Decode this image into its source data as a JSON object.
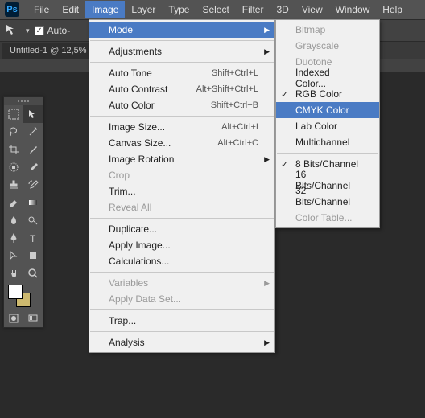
{
  "app_logo": "Ps",
  "menubar": [
    "File",
    "Edit",
    "Image",
    "Layer",
    "Type",
    "Select",
    "Filter",
    "3D",
    "View",
    "Window",
    "Help"
  ],
  "menubar_open_index": 2,
  "optbar": {
    "auto_label": "Auto-"
  },
  "doc_tab": "Untitled-1 @ 12,5%",
  "image_menu": [
    {
      "type": "hl",
      "label": "Mode",
      "arrow": true
    },
    {
      "type": "sep"
    },
    {
      "type": "item",
      "label": "Adjustments",
      "arrow": true
    },
    {
      "type": "sep"
    },
    {
      "type": "item",
      "label": "Auto Tone",
      "shortcut": "Shift+Ctrl+L"
    },
    {
      "type": "item",
      "label": "Auto Contrast",
      "shortcut": "Alt+Shift+Ctrl+L"
    },
    {
      "type": "item",
      "label": "Auto Color",
      "shortcut": "Shift+Ctrl+B"
    },
    {
      "type": "sep"
    },
    {
      "type": "item",
      "label": "Image Size...",
      "shortcut": "Alt+Ctrl+I"
    },
    {
      "type": "item",
      "label": "Canvas Size...",
      "shortcut": "Alt+Ctrl+C"
    },
    {
      "type": "item",
      "label": "Image Rotation",
      "arrow": true
    },
    {
      "type": "disabled",
      "label": "Crop"
    },
    {
      "type": "item",
      "label": "Trim..."
    },
    {
      "type": "disabled",
      "label": "Reveal All"
    },
    {
      "type": "sep"
    },
    {
      "type": "item",
      "label": "Duplicate..."
    },
    {
      "type": "item",
      "label": "Apply Image..."
    },
    {
      "type": "item",
      "label": "Calculations..."
    },
    {
      "type": "sep"
    },
    {
      "type": "disabled",
      "label": "Variables",
      "arrow": true
    },
    {
      "type": "disabled",
      "label": "Apply Data Set..."
    },
    {
      "type": "sep"
    },
    {
      "type": "item",
      "label": "Trap..."
    },
    {
      "type": "sep"
    },
    {
      "type": "item",
      "label": "Analysis",
      "arrow": true
    }
  ],
  "mode_menu": [
    {
      "type": "disabled",
      "label": "Bitmap"
    },
    {
      "type": "disabled",
      "label": "Grayscale"
    },
    {
      "type": "disabled",
      "label": "Duotone"
    },
    {
      "type": "item",
      "label": "Indexed Color..."
    },
    {
      "type": "item",
      "label": "RGB Color",
      "check": true
    },
    {
      "type": "hl",
      "label": "CMYK Color"
    },
    {
      "type": "item",
      "label": "Lab Color"
    },
    {
      "type": "item",
      "label": "Multichannel"
    },
    {
      "type": "sep"
    },
    {
      "type": "item",
      "label": "8 Bits/Channel",
      "check": true
    },
    {
      "type": "item",
      "label": "16 Bits/Channel"
    },
    {
      "type": "item",
      "label": "32 Bits/Channel"
    },
    {
      "type": "sep"
    },
    {
      "type": "disabled",
      "label": "Color Table..."
    }
  ]
}
